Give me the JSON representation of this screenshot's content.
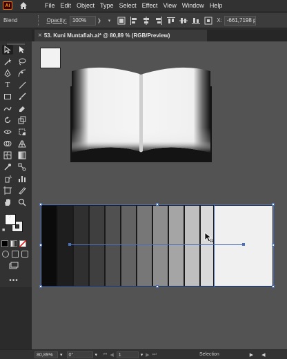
{
  "menubar": {
    "logo": "Ai",
    "items": [
      "File",
      "Edit",
      "Object",
      "Type",
      "Select",
      "Effect",
      "View",
      "Window",
      "Help"
    ]
  },
  "controlbar": {
    "blend_label": "Blend",
    "opacity_label": "Opacity:",
    "opacity_value": "100%",
    "x_label": "X:",
    "x_value": "-661,7198 p"
  },
  "document": {
    "tab_title": "53. Kuni Muntafiah.ai* @ 80,89 % (RGB/Preview)"
  },
  "canvas": {
    "background": "#535353",
    "gradient_steps": [
      "#0b0b0b",
      "#1e1e1e",
      "#303030",
      "#3f3f3f",
      "#505050",
      "#636363",
      "#777777",
      "#8d8d8d",
      "#a5a5a5",
      "#bfbfbf",
      "#dadada",
      "#f0f0f0"
    ]
  },
  "statusbar": {
    "zoom": "80,89%",
    "rotation": "0°",
    "artboard": "1",
    "tool": "Selection"
  }
}
